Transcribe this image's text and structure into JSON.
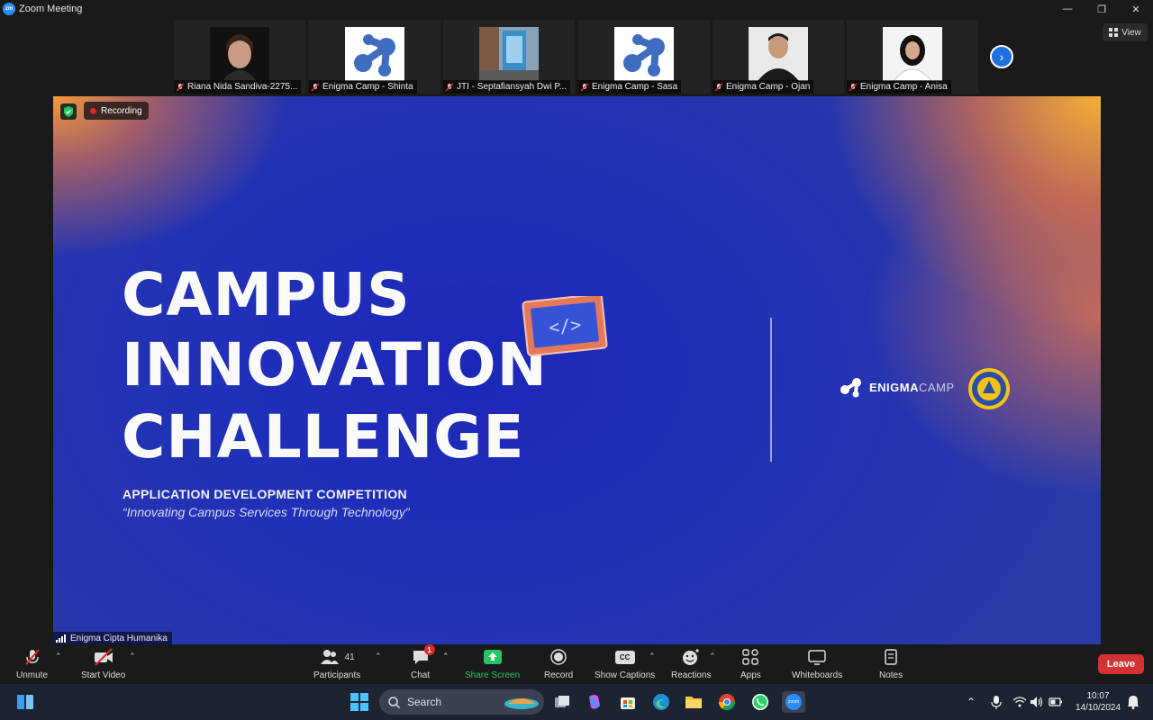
{
  "window": {
    "title": "Zoom Meeting",
    "logo_text": "zm"
  },
  "view_button": {
    "label": "View"
  },
  "participants_strip": [
    {
      "name": "Riana Nida Sandiva-2275...",
      "avatar": "photo-girl-icon"
    },
    {
      "name": "Enigma Camp - Shinta",
      "avatar": "enigma-logo-icon"
    },
    {
      "name": "JTI - Septafiansyah Dwi P...",
      "avatar": "photo-street-icon"
    },
    {
      "name": "Enigma Camp - Sasa",
      "avatar": "enigma-logo-icon"
    },
    {
      "name": "Enigma Camp - Ojan",
      "avatar": "photo-man-icon"
    },
    {
      "name": "Enigma Camp - Anisa",
      "avatar": "photo-hijab-icon"
    }
  ],
  "recording": {
    "label": "Recording"
  },
  "slide": {
    "line1": "CAMPUS",
    "line2": "INNOVATION",
    "line3": "CHALLENGE",
    "subtitle": "APPLICATION DEVELOPMENT COMPETITION",
    "tagline": "“Innovating Campus Services Through Technology”",
    "laptop_code": "</>",
    "brand_bold": "ENIGMA",
    "brand_light": "CAMP"
  },
  "presenter": {
    "name": "Enigma Cipta Humanika"
  },
  "toolbar": {
    "unmute": "Unmute",
    "start_video": "Start Video",
    "participants": "Participants",
    "participants_count": "41",
    "chat": "Chat",
    "chat_badge": "1",
    "share_screen": "Share Screen",
    "record": "Record",
    "show_captions": "Show Captions",
    "captions_icon_text": "CC",
    "reactions": "Reactions",
    "apps": "Apps",
    "whiteboards": "Whiteboards",
    "notes": "Notes",
    "leave": "Leave"
  },
  "taskbar": {
    "search_label": "Search",
    "zoom_icon_text": "zoom",
    "time": "10:07",
    "date": "14/10/2024"
  },
  "colors": {
    "accent_blue": "#2d8cff",
    "share_green": "#22c55e",
    "leave_red": "#d33232"
  }
}
